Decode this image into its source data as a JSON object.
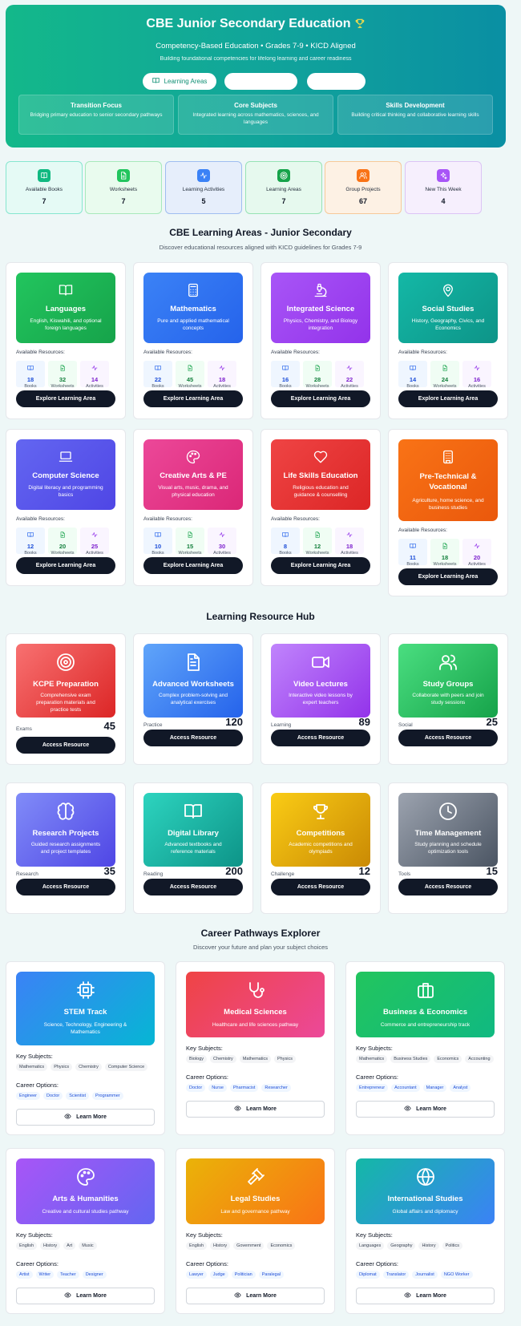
{
  "hero": {
    "title": "CBE Junior Secondary Education",
    "subtitle": "Competency-Based Education • Grades 7-9 • KICD Aligned",
    "tagline": "Building foundational competencies for lifelong learning and career readiness",
    "button_primary": "Learning Areas",
    "button_2": "",
    "button_3": "",
    "cards": [
      {
        "title": "Transition Focus",
        "desc": "Bridging primary education to senior secondary pathways"
      },
      {
        "title": "Core Subjects",
        "desc": "Integrated learning across mathematics, sciences, and languages"
      },
      {
        "title": "Skills Development",
        "desc": "Building critical thinking and collaborative learning skills"
      }
    ]
  },
  "stats": [
    {
      "label": "Available Books",
      "value": "7",
      "icon": "book-icon",
      "bg": "#e5faf5",
      "border": "#86e6cf",
      "iconbg": "#10b981"
    },
    {
      "label": "Worksheets",
      "value": "7",
      "icon": "document-icon",
      "bg": "#e9fbee",
      "border": "#a7e9bb",
      "iconbg": "#22c55e"
    },
    {
      "label": "Learning Activities",
      "value": "5",
      "icon": "activity-icon",
      "bg": "#e6eefb",
      "border": "#9fbdf0",
      "iconbg": "#3b82f6"
    },
    {
      "label": "Learning Areas",
      "value": "7",
      "icon": "target-icon",
      "bg": "#e6f9ee",
      "border": "#97e3b5",
      "iconbg": "#16a34a"
    },
    {
      "label": "Group Projects",
      "value": "67",
      "icon": "users-icon",
      "bg": "#fdf1e4",
      "border": "#f7c999",
      "iconbg": "#f97316"
    },
    {
      "label": "New This Week",
      "value": "4",
      "icon": "sparkles-icon",
      "bg": "#f6effd",
      "border": "#dcc4f5",
      "iconbg": "#a855f7"
    }
  ],
  "learning_areas": {
    "title": "CBE Learning Areas - Junior Secondary",
    "subtitle": "Discover educational resources aligned with KICD guidelines for Grades 7-9",
    "resources_label": "Available Resources:",
    "button": "Explore Learning Area",
    "labels": {
      "books": "Books",
      "worksheets": "Worksheets",
      "activities": "Activities"
    },
    "items": [
      {
        "title": "Languages",
        "desc": "English, Kiswahili, and optional foreign languages",
        "books": "18",
        "worksheets": "32",
        "activities": "14",
        "icon": "book-open-icon",
        "c1": "#22c55e",
        "c2": "#16a34a"
      },
      {
        "title": "Mathematics",
        "desc": "Pure and applied mathematical concepts",
        "books": "22",
        "worksheets": "45",
        "activities": "18",
        "icon": "calculator-icon",
        "c1": "#3b82f6",
        "c2": "#2563eb"
      },
      {
        "title": "Integrated Science",
        "desc": "Physics, Chemistry, and Biology integration",
        "books": "16",
        "worksheets": "28",
        "activities": "22",
        "icon": "microscope-icon",
        "c1": "#a855f7",
        "c2": "#9333ea"
      },
      {
        "title": "Social Studies",
        "desc": "History, Geography, Civics, and Economics",
        "books": "14",
        "worksheets": "24",
        "activities": "16",
        "icon": "map-pin-icon",
        "c1": "#14b8a6",
        "c2": "#0d9488"
      },
      {
        "title": "Computer Science",
        "desc": "Digital literacy and programming basics",
        "books": "12",
        "worksheets": "20",
        "activities": "25",
        "icon": "laptop-icon",
        "c1": "#6366f1",
        "c2": "#4f46e5"
      },
      {
        "title": "Creative Arts & PE",
        "desc": "Visual arts, music, drama, and physical education",
        "books": "10",
        "worksheets": "15",
        "activities": "30",
        "icon": "palette-icon",
        "c1": "#ec4899",
        "c2": "#db2777"
      },
      {
        "title": "Life Skills Education",
        "desc": "Religious education and guidance & counselling",
        "books": "8",
        "worksheets": "12",
        "activities": "18",
        "icon": "heart-icon",
        "c1": "#ef4444",
        "c2": "#dc2626"
      },
      {
        "title": "Pre-Technical & Vocational",
        "desc": "Agriculture, home science, and business studies",
        "books": "11",
        "worksheets": "18",
        "activities": "20",
        "icon": "building-icon",
        "c1": "#f97316",
        "c2": "#ea580c"
      }
    ]
  },
  "hub": {
    "title": "Learning Resource Hub",
    "button": "Access Resource",
    "items": [
      {
        "title": "KCPE Preparation",
        "desc": "Comprehensive exam preparation materials and practice tests",
        "kind": "Exams",
        "count": "45",
        "icon": "target-icon",
        "c1": "#f87171",
        "c2": "#dc2626"
      },
      {
        "title": "Advanced Worksheets",
        "desc": "Complex problem-solving and analytical exercises",
        "kind": "Practice",
        "count": "120",
        "icon": "file-text-icon",
        "c1": "#60a5fa",
        "c2": "#2563eb"
      },
      {
        "title": "Video Lectures",
        "desc": "Interactive video lessons by expert teachers",
        "kind": "Learning",
        "count": "89",
        "icon": "video-icon",
        "c1": "#c084fc",
        "c2": "#9333ea"
      },
      {
        "title": "Study Groups",
        "desc": "Collaborate with peers and join study sessions",
        "kind": "Social",
        "count": "25",
        "icon": "users-icon",
        "c1": "#4ade80",
        "c2": "#16a34a"
      },
      {
        "title": "Research Projects",
        "desc": "Guided research assignments and project templates",
        "kind": "Research",
        "count": "35",
        "icon": "brain-icon",
        "c1": "#818cf8",
        "c2": "#4f46e5"
      },
      {
        "title": "Digital Library",
        "desc": "Advanced textbooks and reference materials",
        "kind": "Reading",
        "count": "200",
        "icon": "book-open-icon",
        "c1": "#2dd4bf",
        "c2": "#0d9488"
      },
      {
        "title": "Competitions",
        "desc": "Academic competitions and olympiads",
        "kind": "Challenge",
        "count": "12",
        "icon": "trophy-icon",
        "c1": "#facc15",
        "c2": "#ca8a04"
      },
      {
        "title": "Time Management",
        "desc": "Study planning and schedule optimization tools",
        "kind": "Tools",
        "count": "15",
        "icon": "clock-icon",
        "c1": "#9ca3af",
        "c2": "#4b5563"
      }
    ]
  },
  "careers": {
    "title": "Career Pathways Explorer",
    "subtitle": "Discover your future and plan your subject choices",
    "key_label": "Key Subjects:",
    "options_label": "Career Options:",
    "button": "Learn More",
    "items": [
      {
        "title": "STEM Track",
        "desc": "Science, Technology, Engineering & Mathematics",
        "subjects": [
          "Mathematics",
          "Physics",
          "Chemistry",
          "Computer Science"
        ],
        "careers": [
          "Engineer",
          "Doctor",
          "Scientist",
          "Programmer"
        ],
        "icon": "cpu-icon",
        "c1": "#3b82f6",
        "c2": "#06b6d4"
      },
      {
        "title": "Medical Sciences",
        "desc": "Healthcare and life sciences pathway",
        "subjects": [
          "Biology",
          "Chemistry",
          "Mathematics",
          "Physics"
        ],
        "careers": [
          "Doctor",
          "Nurse",
          "Pharmacist",
          "Researcher"
        ],
        "icon": "stethoscope-icon",
        "c1": "#ef4444",
        "c2": "#ec4899"
      },
      {
        "title": "Business & Economics",
        "desc": "Commerce and entrepreneurship track",
        "subjects": [
          "Mathematics",
          "Business Studies",
          "Economics",
          "Accounting"
        ],
        "careers": [
          "Entrepreneur",
          "Accountant",
          "Manager",
          "Analyst"
        ],
        "icon": "briefcase-icon",
        "c1": "#22c55e",
        "c2": "#10b981"
      },
      {
        "title": "Arts & Humanities",
        "desc": "Creative and cultural studies pathway",
        "subjects": [
          "English",
          "History",
          "Art",
          "Music"
        ],
        "careers": [
          "Artist",
          "Writer",
          "Teacher",
          "Designer"
        ],
        "icon": "palette-icon",
        "c1": "#a855f7",
        "c2": "#6366f1"
      },
      {
        "title": "Legal Studies",
        "desc": "Law and governance pathway",
        "subjects": [
          "English",
          "History",
          "Government",
          "Economics"
        ],
        "careers": [
          "Lawyer",
          "Judge",
          "Politician",
          "Paralegal"
        ],
        "icon": "gavel-icon",
        "c1": "#eab308",
        "c2": "#f97316"
      },
      {
        "title": "International Studies",
        "desc": "Global affairs and diplomacy",
        "subjects": [
          "Languages",
          "Geography",
          "History",
          "Politics"
        ],
        "careers": [
          "Diplomat",
          "Translator",
          "Journalist",
          "NGO Worker"
        ],
        "icon": "globe-icon",
        "c1": "#14b8a6",
        "c2": "#3b82f6"
      }
    ]
  }
}
